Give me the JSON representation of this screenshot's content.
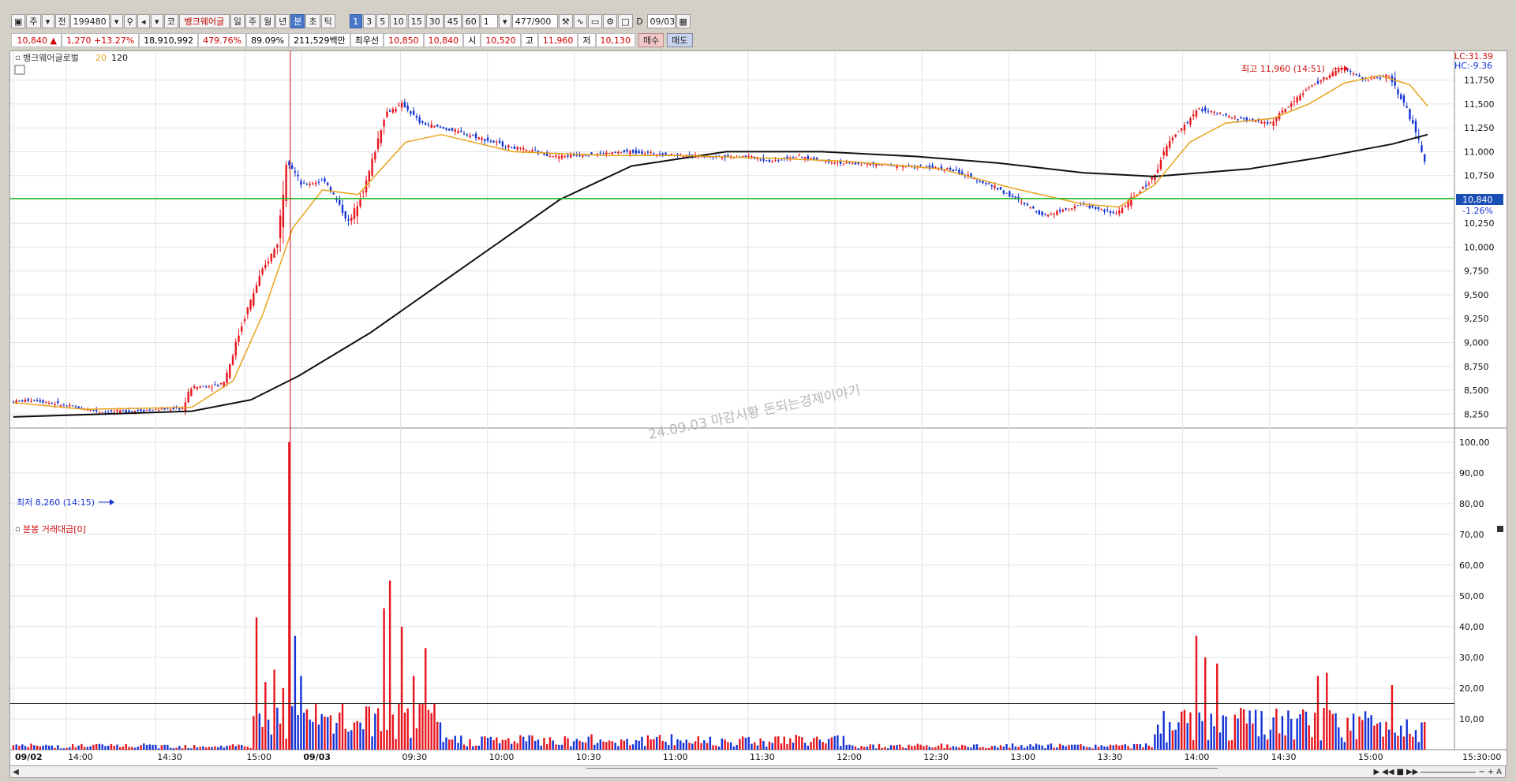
{
  "toolbar": {
    "market_btn": "주",
    "all_btn": "전",
    "code": "199480",
    "exchange": "코",
    "stock_name": "뱅크웨어글",
    "period_tabs": [
      "일",
      "주",
      "월",
      "년",
      "분",
      "초",
      "틱"
    ],
    "active_period": "분",
    "interval_btns": [
      "1",
      "3",
      "5",
      "10",
      "15",
      "30",
      "45",
      "60"
    ],
    "active_interval": "1",
    "multiplier": "1",
    "count": "477",
    "count_max": "/900",
    "d_label": "D",
    "date": "09/03"
  },
  "info": {
    "price": "10,840",
    "arrow": "▲",
    "change": "1,270",
    "change_pct": "+13.27%",
    "volume": "18,910,992",
    "vol_ratio": "479.76%",
    "ratio2": "89.09%",
    "amount": "211,529백만",
    "best_label": "최우선",
    "best_ask": "10,850",
    "best_bid": "10,840",
    "open_label": "시",
    "open": "10,520",
    "high_label": "고",
    "high": "11,960",
    "low_label": "저",
    "low": "10,130",
    "buy_btn": "매수",
    "sell_btn": "매도"
  },
  "price_panel": {
    "title": "뱅크웨어글로벌",
    "ma_short_label": "20",
    "ma_long_label": "120",
    "lc_label": "LC:31.39",
    "hc_label": "HC:-9.36",
    "high_annotation": "최고 11,960 (14:51)",
    "low_annotation": "최저 8,260 (14:15)",
    "current_price_tag": "10,840",
    "current_pct_tag": "-1.26%",
    "watermark": "24.09.03 마감시황 돈되는경제이야기",
    "colors": {
      "up": "#e8141c",
      "down": "#1433d6",
      "ma20": "#e8a21a",
      "ma120": "#111111",
      "support": "#20c020",
      "cursor": "#d01010"
    }
  },
  "volume_panel": {
    "title": "분봉 거래대금[0]"
  },
  "scroll": {
    "left": "◀",
    "nav": [
      "▶",
      "◀◀",
      "■",
      "▶▶"
    ],
    "zoom_out": "−",
    "zoom_in": "+",
    "label_a": "A"
  },
  "chart_data": [
    {
      "type": "candlestick",
      "title": "뱅크웨어글로벌",
      "y_ticks": [
        8250,
        8500,
        8750,
        9000,
        9250,
        9500,
        9750,
        10000,
        10250,
        10500,
        10750,
        11000,
        11250,
        11500,
        11750
      ],
      "y_tick_labels": [
        "8,250",
        "8,500",
        "8,750",
        "9,000",
        "9,250",
        "9,500",
        "9,750",
        "10,000",
        "10,250",
        "10,500",
        "10,750",
        "11,000",
        "11,250",
        "11,500",
        "11,750"
      ],
      "ylim": [
        8120,
        12020
      ],
      "support_level": 10510,
      "x_labels": [
        "09/02",
        "14:00",
        "14:30",
        "15:00",
        "09/03",
        "09:30",
        "10:00",
        "10:30",
        "11:00",
        "11:30",
        "12:00",
        "12:30",
        "13:00",
        "13:30",
        "14:00",
        "14:30",
        "15:00",
        "15:30:00"
      ],
      "price_path": [
        [
          0,
          8380
        ],
        [
          20,
          8400
        ],
        [
          50,
          8330
        ],
        [
          80,
          8270
        ],
        [
          110,
          8290
        ],
        [
          145,
          8310
        ],
        [
          152,
          8530
        ],
        [
          175,
          8550
        ],
        [
          180,
          8600
        ],
        [
          195,
          9200
        ],
        [
          210,
          9700
        ],
        [
          225,
          10050
        ],
        [
          232,
          10950
        ],
        [
          245,
          10650
        ],
        [
          265,
          10700
        ],
        [
          285,
          10250
        ],
        [
          300,
          10700
        ],
        [
          315,
          11400
        ],
        [
          330,
          11500
        ],
        [
          345,
          11300
        ],
        [
          380,
          11200
        ],
        [
          420,
          11050
        ],
        [
          460,
          10950
        ],
        [
          520,
          11000
        ],
        [
          580,
          10950
        ],
        [
          620,
          10950
        ],
        [
          640,
          10900
        ],
        [
          660,
          10950
        ],
        [
          700,
          10880
        ],
        [
          740,
          10860
        ],
        [
          790,
          10820
        ],
        [
          830,
          10620
        ],
        [
          870,
          10330
        ],
        [
          900,
          10450
        ],
        [
          930,
          10350
        ],
        [
          960,
          10700
        ],
        [
          975,
          11100
        ],
        [
          1000,
          11450
        ],
        [
          1030,
          11350
        ],
        [
          1060,
          11300
        ],
        [
          1090,
          11650
        ],
        [
          1120,
          11880
        ],
        [
          1140,
          11750
        ],
        [
          1160,
          11800
        ],
        [
          1175,
          11450
        ],
        [
          1190,
          10920
        ]
      ],
      "ma20_path": [
        [
          0,
          8370
        ],
        [
          60,
          8300
        ],
        [
          150,
          8320
        ],
        [
          185,
          8600
        ],
        [
          210,
          9300
        ],
        [
          235,
          10200
        ],
        [
          260,
          10600
        ],
        [
          290,
          10550
        ],
        [
          330,
          11100
        ],
        [
          360,
          11180
        ],
        [
          420,
          11000
        ],
        [
          500,
          10960
        ],
        [
          560,
          10960
        ],
        [
          640,
          10930
        ],
        [
          700,
          10900
        ],
        [
          780,
          10820
        ],
        [
          840,
          10620
        ],
        [
          900,
          10450
        ],
        [
          930,
          10420
        ],
        [
          960,
          10650
        ],
        [
          990,
          11100
        ],
        [
          1020,
          11300
        ],
        [
          1060,
          11350
        ],
        [
          1090,
          11500
        ],
        [
          1120,
          11720
        ],
        [
          1150,
          11800
        ],
        [
          1175,
          11700
        ],
        [
          1190,
          11480
        ]
      ],
      "ma120_path": [
        [
          0,
          8220
        ],
        [
          150,
          8280
        ],
        [
          200,
          8400
        ],
        [
          240,
          8650
        ],
        [
          300,
          9100
        ],
        [
          380,
          9800
        ],
        [
          460,
          10500
        ],
        [
          520,
          10850
        ],
        [
          600,
          11000
        ],
        [
          680,
          11000
        ],
        [
          760,
          10950
        ],
        [
          830,
          10880
        ],
        [
          900,
          10780
        ],
        [
          960,
          10740
        ],
        [
          1040,
          10820
        ],
        [
          1100,
          10940
        ],
        [
          1160,
          11080
        ],
        [
          1190,
          11180
        ]
      ],
      "high": {
        "value": 11960,
        "time": "14:51"
      },
      "low": {
        "value": 8260,
        "time": "14:15"
      }
    },
    {
      "type": "bar",
      "title": "분봉 거래대금[0]",
      "y_ticks": [
        10,
        20,
        30,
        40,
        50,
        60,
        70,
        80,
        90,
        100
      ],
      "y_tick_labels": [
        "10,00",
        "20,00",
        "30,00",
        "40,00",
        "50,00",
        "60,00",
        "70,00",
        "80,00",
        "90,00",
        "100,00"
      ],
      "ylim": [
        0,
        102
      ],
      "reference_level": 15,
      "spikes": [
        [
          204,
          43,
          "up"
        ],
        [
          212,
          22,
          "up"
        ],
        [
          220,
          26,
          "up"
        ],
        [
          228,
          20,
          "up"
        ],
        [
          233,
          100,
          "up"
        ],
        [
          236,
          37,
          "down"
        ],
        [
          242,
          24,
          "down"
        ],
        [
          318,
          55,
          "up"
        ],
        [
          312,
          46,
          "up"
        ],
        [
          328,
          40,
          "up"
        ],
        [
          338,
          24,
          "up"
        ],
        [
          346,
          33,
          "up"
        ],
        [
          995,
          37,
          "up"
        ],
        [
          1002,
          30,
          "up"
        ],
        [
          1012,
          28,
          "up"
        ],
        [
          1098,
          24,
          "up"
        ],
        [
          1104,
          25,
          "up"
        ],
        [
          1160,
          21,
          "up"
        ]
      ]
    }
  ]
}
